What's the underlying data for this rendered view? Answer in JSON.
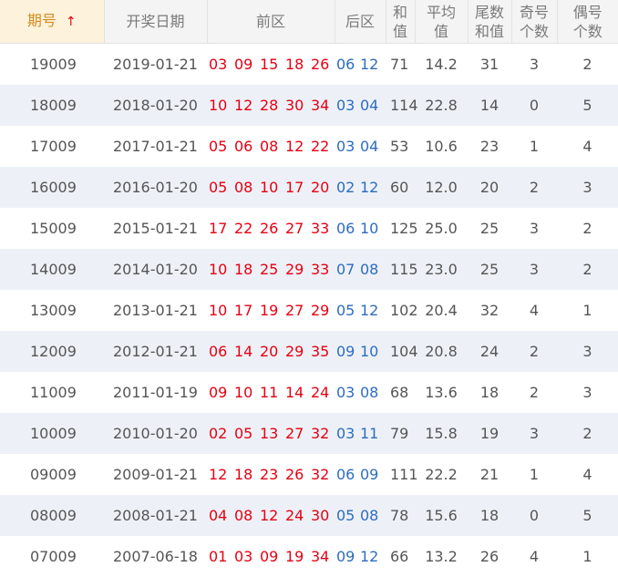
{
  "headers": {
    "issue": "期号",
    "sort_arrow": "↑",
    "date": "开奖日期",
    "front": "前区",
    "back": "后区",
    "sum": [
      "和",
      "值"
    ],
    "avg": [
      "平均",
      "值"
    ],
    "tail_sum": [
      "尾数",
      "和值"
    ],
    "odd": [
      "奇号",
      "个数"
    ],
    "even": [
      "偶号",
      "个数"
    ]
  },
  "colors": {
    "front": "#e60012",
    "back": "#2d6cc0",
    "sorted_header": "#d48c22",
    "stripe": "#edf1f7"
  },
  "rows": [
    {
      "issue": "19009",
      "date": "2019-01-21",
      "front": [
        "03",
        "09",
        "15",
        "18",
        "26"
      ],
      "back": [
        "06",
        "12"
      ],
      "sum": "71",
      "avg": "14.2",
      "tail": "31",
      "odd": "3",
      "even": "2"
    },
    {
      "issue": "18009",
      "date": "2018-01-20",
      "front": [
        "10",
        "12",
        "28",
        "30",
        "34"
      ],
      "back": [
        "03",
        "04"
      ],
      "sum": "114",
      "avg": "22.8",
      "tail": "14",
      "odd": "0",
      "even": "5"
    },
    {
      "issue": "17009",
      "date": "2017-01-21",
      "front": [
        "05",
        "06",
        "08",
        "12",
        "22"
      ],
      "back": [
        "03",
        "04"
      ],
      "sum": "53",
      "avg": "10.6",
      "tail": "23",
      "odd": "1",
      "even": "4"
    },
    {
      "issue": "16009",
      "date": "2016-01-20",
      "front": [
        "05",
        "08",
        "10",
        "17",
        "20"
      ],
      "back": [
        "02",
        "12"
      ],
      "sum": "60",
      "avg": "12.0",
      "tail": "20",
      "odd": "2",
      "even": "3"
    },
    {
      "issue": "15009",
      "date": "2015-01-21",
      "front": [
        "17",
        "22",
        "26",
        "27",
        "33"
      ],
      "back": [
        "06",
        "10"
      ],
      "sum": "125",
      "avg": "25.0",
      "tail": "25",
      "odd": "3",
      "even": "2"
    },
    {
      "issue": "14009",
      "date": "2014-01-20",
      "front": [
        "10",
        "18",
        "25",
        "29",
        "33"
      ],
      "back": [
        "07",
        "08"
      ],
      "sum": "115",
      "avg": "23.0",
      "tail": "25",
      "odd": "3",
      "even": "2"
    },
    {
      "issue": "13009",
      "date": "2013-01-21",
      "front": [
        "10",
        "17",
        "19",
        "27",
        "29"
      ],
      "back": [
        "05",
        "12"
      ],
      "sum": "102",
      "avg": "20.4",
      "tail": "32",
      "odd": "4",
      "even": "1"
    },
    {
      "issue": "12009",
      "date": "2012-01-21",
      "front": [
        "06",
        "14",
        "20",
        "29",
        "35"
      ],
      "back": [
        "09",
        "10"
      ],
      "sum": "104",
      "avg": "20.8",
      "tail": "24",
      "odd": "2",
      "even": "3"
    },
    {
      "issue": "11009",
      "date": "2011-01-19",
      "front": [
        "09",
        "10",
        "11",
        "14",
        "24"
      ],
      "back": [
        "03",
        "08"
      ],
      "sum": "68",
      "avg": "13.6",
      "tail": "18",
      "odd": "2",
      "even": "3"
    },
    {
      "issue": "10009",
      "date": "2010-01-20",
      "front": [
        "02",
        "05",
        "13",
        "27",
        "32"
      ],
      "back": [
        "03",
        "11"
      ],
      "sum": "79",
      "avg": "15.8",
      "tail": "19",
      "odd": "3",
      "even": "2"
    },
    {
      "issue": "09009",
      "date": "2009-01-21",
      "front": [
        "12",
        "18",
        "23",
        "26",
        "32"
      ],
      "back": [
        "06",
        "09"
      ],
      "sum": "111",
      "avg": "22.2",
      "tail": "21",
      "odd": "1",
      "even": "4"
    },
    {
      "issue": "08009",
      "date": "2008-01-21",
      "front": [
        "04",
        "08",
        "12",
        "24",
        "30"
      ],
      "back": [
        "05",
        "08"
      ],
      "sum": "78",
      "avg": "15.6",
      "tail": "18",
      "odd": "0",
      "even": "5"
    },
    {
      "issue": "07009",
      "date": "2007-06-18",
      "front": [
        "01",
        "03",
        "09",
        "19",
        "34"
      ],
      "back": [
        "09",
        "12"
      ],
      "sum": "66",
      "avg": "13.2",
      "tail": "26",
      "odd": "4",
      "even": "1"
    }
  ]
}
